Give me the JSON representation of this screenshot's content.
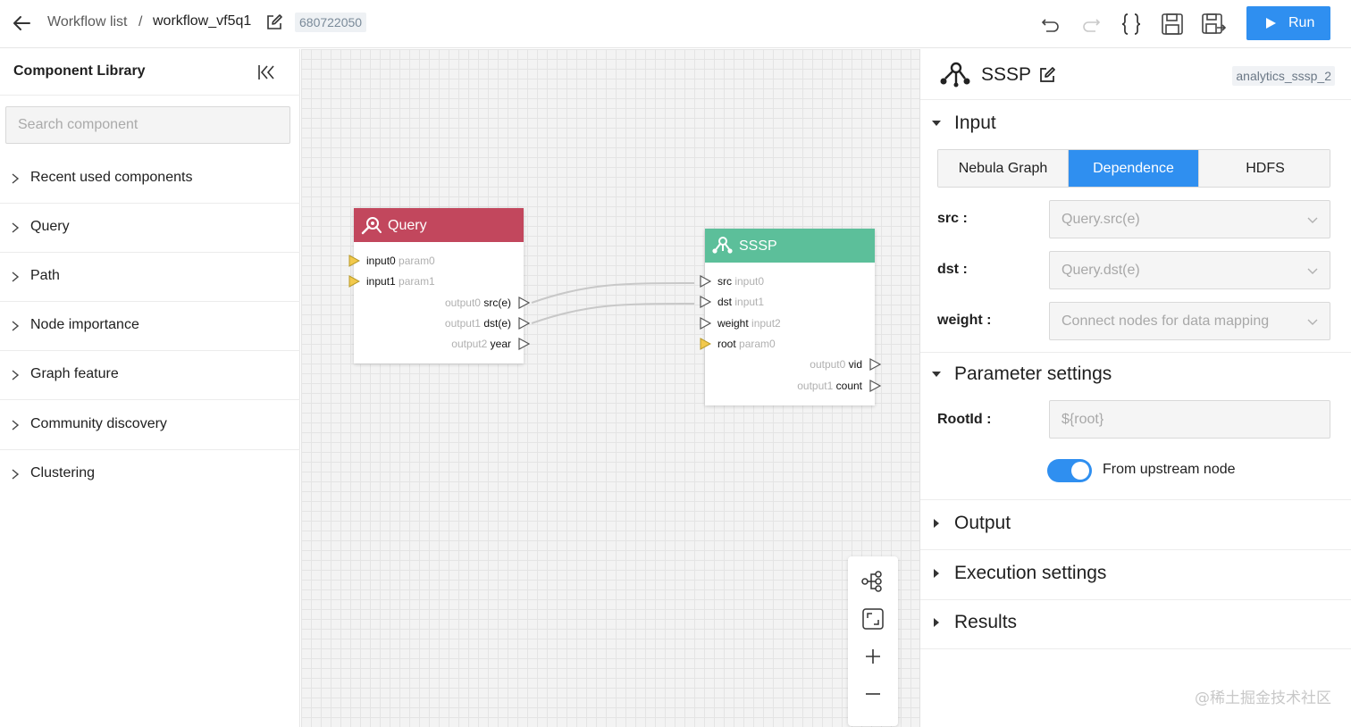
{
  "topbar": {
    "breadcrumb_root": "Workflow list",
    "breadcrumb_sep": "/",
    "workflow_name": "workflow_vf5q1",
    "workflow_id": "680722050",
    "run_label": "Run"
  },
  "library": {
    "title": "Component Library",
    "search_placeholder": "Search component",
    "categories": [
      "Recent used components",
      "Query",
      "Path",
      "Node importance",
      "Graph feature",
      "Community discovery",
      "Clustering"
    ]
  },
  "canvas": {
    "nodes": {
      "query": {
        "title": "Query",
        "color": "#c2475d",
        "inputs": [
          {
            "name": "input0",
            "alias": "param0"
          },
          {
            "name": "input1",
            "alias": "param1"
          }
        ],
        "outputs": [
          {
            "alias": "output0",
            "name": "src(e)"
          },
          {
            "alias": "output1",
            "name": "dst(e)"
          },
          {
            "alias": "output2",
            "name": "year"
          }
        ]
      },
      "sssp": {
        "title": "SSSP",
        "color": "#5cbf9a",
        "inputs": [
          {
            "name": "src",
            "alias": "input0"
          },
          {
            "name": "dst",
            "alias": "input1"
          },
          {
            "name": "weight",
            "alias": "input2"
          },
          {
            "name": "root",
            "alias": "param0"
          }
        ],
        "outputs": [
          {
            "alias": "output0",
            "name": "vid"
          },
          {
            "alias": "output1",
            "name": "count"
          }
        ]
      }
    },
    "edge_color": "#c8c8c8",
    "param_port_color": "#f2c94c"
  },
  "inspector": {
    "title": "SSSP",
    "component_id": "analytics_sssp_2",
    "input_section": "Input",
    "source_tabs": [
      "Nebula Graph",
      "Dependence",
      "HDFS"
    ],
    "active_tab": "Dependence",
    "fields": {
      "src": {
        "label": "src",
        "value": "Query.src(e)"
      },
      "dst": {
        "label": "dst",
        "value": "Query.dst(e)"
      },
      "weight": {
        "label": "weight",
        "value": "Connect nodes for data mapping"
      }
    },
    "param_section": "Parameter settings",
    "rootid": {
      "label": "RootId",
      "value": "${root}"
    },
    "toggle_label": "From upstream node",
    "toggle_on": true,
    "sections": [
      "Output",
      "Execution settings",
      "Results"
    ],
    "accent_color": "#2f8ff0"
  },
  "watermark": "@稀土掘金技术社区"
}
